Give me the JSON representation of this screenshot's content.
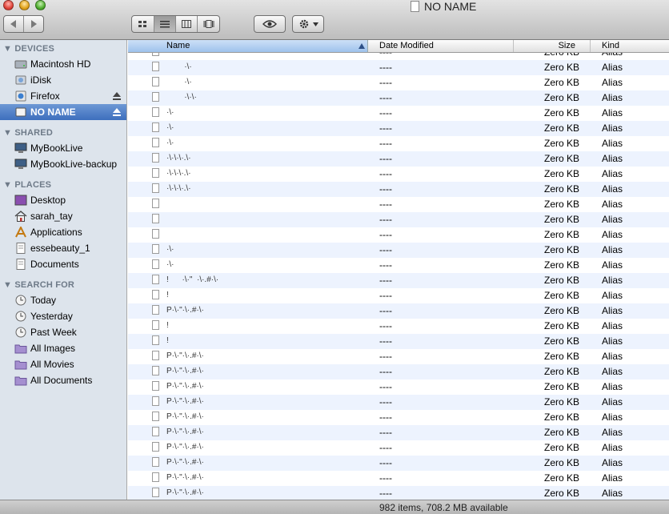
{
  "window": {
    "title": "NO NAME"
  },
  "toolbar": {
    "nav": {
      "back_icon": "chevron-left-icon",
      "forward_icon": "chevron-right-icon"
    },
    "views": [
      {
        "name": "icon-view",
        "icon": "grid-icon",
        "active": false
      },
      {
        "name": "list-view",
        "icon": "list-icon",
        "active": true
      },
      {
        "name": "column-view",
        "icon": "columns-icon",
        "active": false
      },
      {
        "name": "coverflow-view",
        "icon": "coverflow-icon",
        "active": false
      }
    ],
    "quicklook_icon": "eye-icon",
    "action_icon": "gear-icon"
  },
  "sidebar": {
    "devices": {
      "header": "DEVICES",
      "items": [
        {
          "label": "Macintosh HD",
          "icon": "hard-drive-icon"
        },
        {
          "label": "iDisk",
          "icon": "idisk-icon"
        },
        {
          "label": "Firefox",
          "icon": "disk-image-icon"
        },
        {
          "label": "NO NAME",
          "icon": "usb-drive-icon"
        }
      ]
    },
    "shared": {
      "header": "SHARED",
      "items": [
        {
          "label": "MyBookLive",
          "icon": "network-computer-icon"
        },
        {
          "label": "MyBookLive-backup",
          "icon": "network-computer-icon"
        }
      ]
    },
    "places": {
      "header": "PLACES",
      "items": [
        {
          "label": "Desktop",
          "icon": "desktop-icon"
        },
        {
          "label": "sarah_tay",
          "icon": "home-icon"
        },
        {
          "label": "Applications",
          "icon": "applications-icon"
        },
        {
          "label": "essebeauty_1",
          "icon": "document-icon"
        },
        {
          "label": "Documents",
          "icon": "document-icon"
        }
      ]
    },
    "search": {
      "header": "SEARCH FOR",
      "items": [
        {
          "label": "Today",
          "icon": "clock-icon"
        },
        {
          "label": "Yesterday",
          "icon": "clock-icon"
        },
        {
          "label": "Past Week",
          "icon": "clock-icon"
        },
        {
          "label": "All Images",
          "icon": "smart-folder-icon"
        },
        {
          "label": "All Movies",
          "icon": "smart-folder-icon"
        },
        {
          "label": "All Documents",
          "icon": "smart-folder-icon"
        }
      ]
    }
  },
  "columns": {
    "name": "Name",
    "date": "Date Modified",
    "size": "Size",
    "kind": "Kind"
  },
  "rows": [
    {
      "name": "        ·'·",
      "date": "----",
      "size": "Zero KB",
      "kind": "Alias"
    },
    {
      "name": "        ·\\·",
      "date": "----",
      "size": "Zero KB",
      "kind": "Alias"
    },
    {
      "name": "        ·\\·",
      "date": "----",
      "size": "Zero KB",
      "kind": "Alias"
    },
    {
      "name": "        ·\\·\\·",
      "date": "----",
      "size": "Zero KB",
      "kind": "Alias"
    },
    {
      "name": "·\\·",
      "date": "----",
      "size": "Zero KB",
      "kind": "Alias"
    },
    {
      "name": "·\\·",
      "date": "----",
      "size": "Zero KB",
      "kind": "Alias"
    },
    {
      "name": "·\\·",
      "date": "----",
      "size": "Zero KB",
      "kind": "Alias"
    },
    {
      "name": "·\\·\\·\\·.\\·",
      "date": "----",
      "size": "Zero KB",
      "kind": "Alias"
    },
    {
      "name": "·\\·\\·\\·.\\·",
      "date": "----",
      "size": "Zero KB",
      "kind": "Alias"
    },
    {
      "name": "·\\·\\·\\·.\\·",
      "date": "----",
      "size": "Zero KB",
      "kind": "Alias"
    },
    {
      "name": "",
      "date": "----",
      "size": "Zero KB",
      "kind": "Alias"
    },
    {
      "name": "",
      "date": "----",
      "size": "Zero KB",
      "kind": "Alias"
    },
    {
      "name": "",
      "date": "----",
      "size": "Zero KB",
      "kind": "Alias"
    },
    {
      "name": "·\\·",
      "date": "----",
      "size": "Zero KB",
      "kind": "Alias"
    },
    {
      "name": "·\\·",
      "date": "----",
      "size": "Zero KB",
      "kind": "Alias"
    },
    {
      "name": "!      ·\\·\"  ·\\·.#·\\·",
      "date": "----",
      "size": "Zero KB",
      "kind": "Alias"
    },
    {
      "name": "!",
      "date": "----",
      "size": "Zero KB",
      "kind": "Alias"
    },
    {
      "name": "P·\\·\"·\\·.#·\\·",
      "date": "----",
      "size": "Zero KB",
      "kind": "Alias"
    },
    {
      "name": "!",
      "date": "----",
      "size": "Zero KB",
      "kind": "Alias"
    },
    {
      "name": "!",
      "date": "----",
      "size": "Zero KB",
      "kind": "Alias"
    },
    {
      "name": "P·\\·\"·\\·.#·\\·",
      "date": "----",
      "size": "Zero KB",
      "kind": "Alias"
    },
    {
      "name": "P·\\·\"·\\·.#·\\·",
      "date": "----",
      "size": "Zero KB",
      "kind": "Alias"
    },
    {
      "name": "P·\\·\"·\\·.#·\\·",
      "date": "----",
      "size": "Zero KB",
      "kind": "Alias"
    },
    {
      "name": "P·\\·\"·\\·.#·\\·",
      "date": "----",
      "size": "Zero KB",
      "kind": "Alias"
    },
    {
      "name": "P·\\·\"·\\·.#·\\·",
      "date": "----",
      "size": "Zero KB",
      "kind": "Alias"
    },
    {
      "name": "P·\\·\"·\\·.#·\\·",
      "date": "----",
      "size": "Zero KB",
      "kind": "Alias"
    },
    {
      "name": "P·\\·\"·\\·.#·\\·",
      "date": "----",
      "size": "Zero KB",
      "kind": "Alias"
    },
    {
      "name": "P·\\·\"·\\·.#·\\·",
      "date": "----",
      "size": "Zero KB",
      "kind": "Alias"
    },
    {
      "name": "P·\\·\"·\\·.#·\\·",
      "date": "----",
      "size": "Zero KB",
      "kind": "Alias"
    },
    {
      "name": "P·\\·\"·\\·.#·\\·",
      "date": "----",
      "size": "Zero KB",
      "kind": "Alias"
    }
  ],
  "status": {
    "text": "982 items, 708.2 MB available"
  },
  "colors": {
    "sidebar_bg": "#dde4ec",
    "selection": "#3d6fbd",
    "row_stripe": "#edf3fe"
  }
}
